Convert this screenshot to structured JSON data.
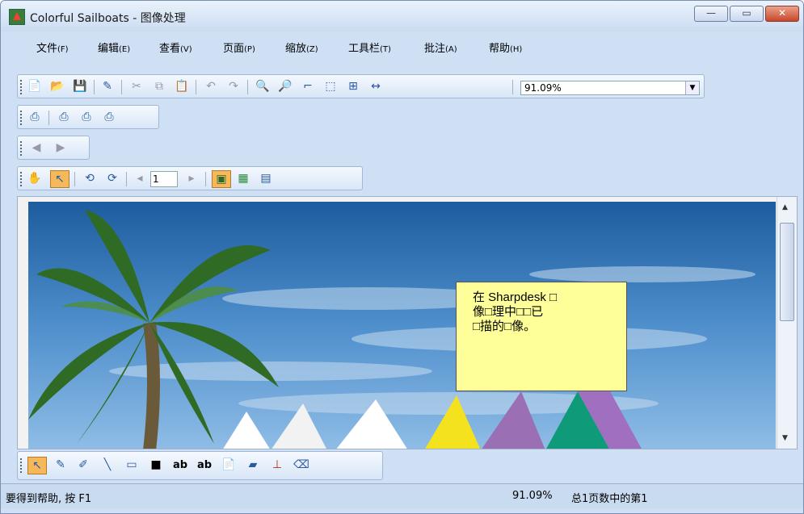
{
  "window": {
    "title": "Colorful Sailboats - 图像处理"
  },
  "window_controls": {
    "minimize": "—",
    "maximize": "▭",
    "close": "✕"
  },
  "menu": [
    {
      "label": "文件",
      "key": "(F)"
    },
    {
      "label": "编辑",
      "key": "(E)"
    },
    {
      "label": "查看",
      "key": "(V)"
    },
    {
      "label": "页面",
      "key": "(P)"
    },
    {
      "label": "缩放",
      "key": "(Z)"
    },
    {
      "label": "工具栏",
      "key": "(T)"
    },
    {
      "label": "批注",
      "key": "(A)"
    },
    {
      "label": "帮助",
      "key": "(H)"
    }
  ],
  "toolbar": {
    "zoom_value": "91.09%",
    "page_number": "1"
  },
  "icons": {
    "new": "📄",
    "open": "📂",
    "save": "💾",
    "scan": "✎",
    "cut": "✂",
    "copy": "⧉",
    "paste": "📋",
    "undo": "↶",
    "redo": "↷",
    "zoom_in": "🔍",
    "zoom_out": "🔎",
    "select_area": "⌐",
    "zoom_rect": "⬚",
    "fit_page": "⊞",
    "fit_width": "↔",
    "print": "⎙",
    "print2": "⎙",
    "print3": "⎙",
    "print4": "⎙",
    "back": "◀",
    "forward": "▶",
    "hand": "✋",
    "pointer": "↖",
    "rotate_left": "⟲",
    "rotate_right": "⟳",
    "prev_page": "◂",
    "next_page": "▸",
    "single_page": "▣",
    "thumbnails": "▦",
    "calendar": "▤",
    "annot_pointer": "↖",
    "pen": "✎",
    "marker": "✐",
    "line": "╲",
    "rect": "▭",
    "filled_rect": "■",
    "text": "ab",
    "text2": "ab",
    "note": "📄",
    "stamp_image": "▰",
    "stamp": "⊥",
    "delete": "⌫"
  },
  "annotation_note": {
    "lines": [
      "在 Sharpdesk □",
      "像□理中□□已",
      "□描的□像。"
    ]
  },
  "status": {
    "help_text": "要得到帮助, 按 F1",
    "zoom": "91.09%",
    "page_info": "总1页数中的第1"
  }
}
